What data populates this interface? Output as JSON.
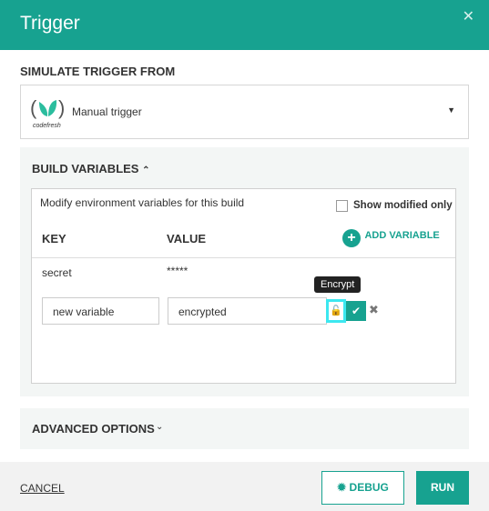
{
  "header": {
    "title": "Trigger",
    "close": "✕"
  },
  "simulate": {
    "label": "SIMULATE TRIGGER FROM",
    "selected": "Manual trigger",
    "logo_text": "codefresh"
  },
  "build_vars": {
    "label": "BUILD VARIABLES",
    "hint": "Modify environment variables for this build",
    "show_modified": "Show modified only",
    "key_header": "KEY",
    "value_header": "VALUE",
    "add_variable": "ADD VARIABLE",
    "rows": [
      {
        "key": "secret",
        "value": "*****"
      }
    ],
    "new_row": {
      "key": "new variable",
      "value": "encrypted"
    },
    "tooltip": "Encrypt"
  },
  "advanced": {
    "label": "ADVANCED OPTIONS"
  },
  "footer": {
    "cancel": "CANCEL",
    "debug": "DEBUG",
    "run": "RUN"
  },
  "colors": {
    "accent": "#17a290",
    "highlight": "#3ce8f0"
  }
}
